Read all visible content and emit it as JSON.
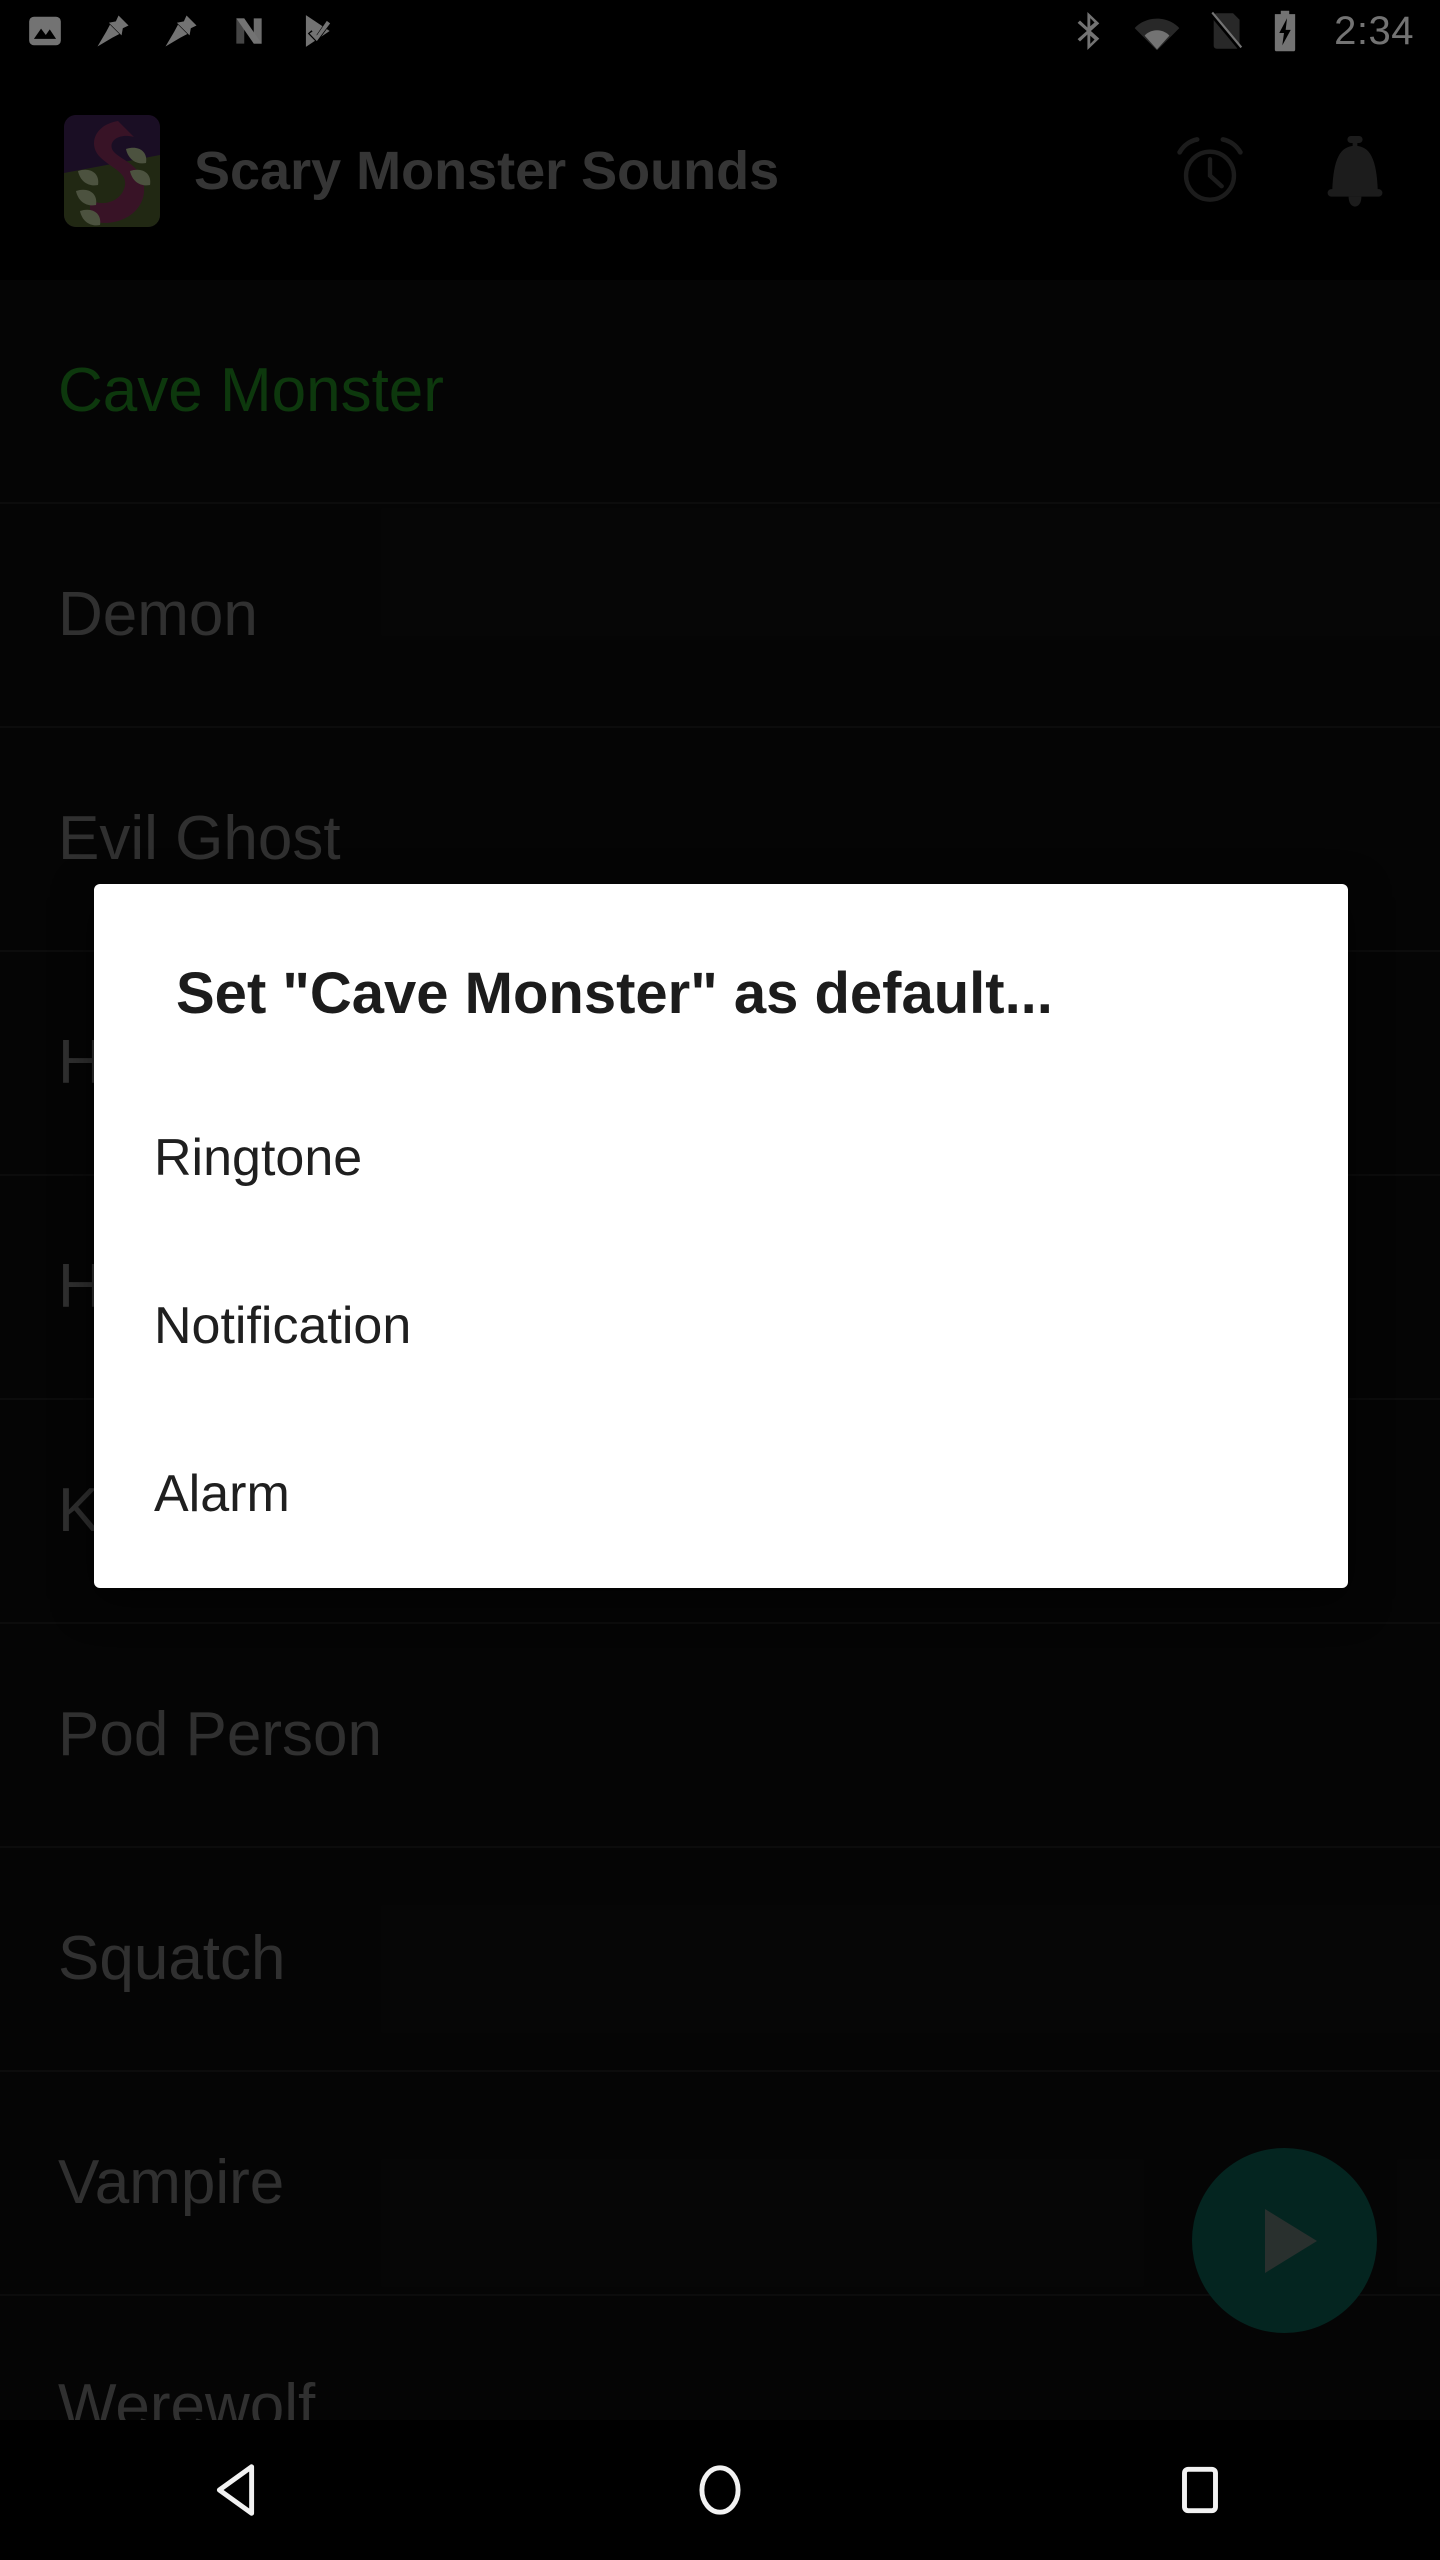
{
  "status_bar": {
    "time": "2:34",
    "notification_icons": [
      {
        "name": "image-icon"
      },
      {
        "name": "pin-icon"
      },
      {
        "name": "pin-icon"
      },
      {
        "name": "nfc-n-icon"
      },
      {
        "name": "check-play-icon"
      }
    ],
    "system_icons": [
      {
        "name": "bluetooth-icon"
      },
      {
        "name": "wifi-icon"
      },
      {
        "name": "no-sim-icon"
      },
      {
        "name": "battery-charging-icon"
      }
    ]
  },
  "app_bar": {
    "title": "Scary Monster Sounds",
    "icon_name": "app-logo-icon",
    "actions": [
      {
        "name": "alarm-clock-icon",
        "label": "Set as alarm"
      },
      {
        "name": "notification-bell-icon",
        "label": "Set as notification"
      }
    ],
    "title_color": "#757575",
    "background": "#000000"
  },
  "sound_list": {
    "selected_index": 0,
    "selected_color": "#1e7d1e",
    "item_color": "#6b6b6b",
    "items": [
      {
        "label": "Cave Monster",
        "selected": true
      },
      {
        "label": "Demon",
        "selected": false
      },
      {
        "label": "Evil Ghost",
        "selected": false
      },
      {
        "label": "H",
        "selected": false
      },
      {
        "label": "H",
        "selected": false
      },
      {
        "label": "K",
        "selected": false
      },
      {
        "label": "Pod Person",
        "selected": false
      },
      {
        "label": "Squatch",
        "selected": false
      },
      {
        "label": "Vampire",
        "selected": false
      },
      {
        "label": "Werewolf",
        "selected": false
      }
    ]
  },
  "fab": {
    "name": "play-fab",
    "icon_name": "play-icon",
    "background": "#0a5247",
    "icon_color": "#5c6b66"
  },
  "dialog": {
    "title": "Set \"Cave Monster\" as default...",
    "background": "#ffffff",
    "title_color": "#1c1c1c",
    "options": [
      {
        "label": "Ringtone"
      },
      {
        "label": "Notification"
      },
      {
        "label": "Alarm"
      }
    ]
  },
  "nav_bar": {
    "buttons": [
      {
        "name": "back-button",
        "icon": "triangle-left-icon"
      },
      {
        "name": "home-button",
        "icon": "circle-icon"
      },
      {
        "name": "recents-button",
        "icon": "square-icon"
      }
    ]
  }
}
